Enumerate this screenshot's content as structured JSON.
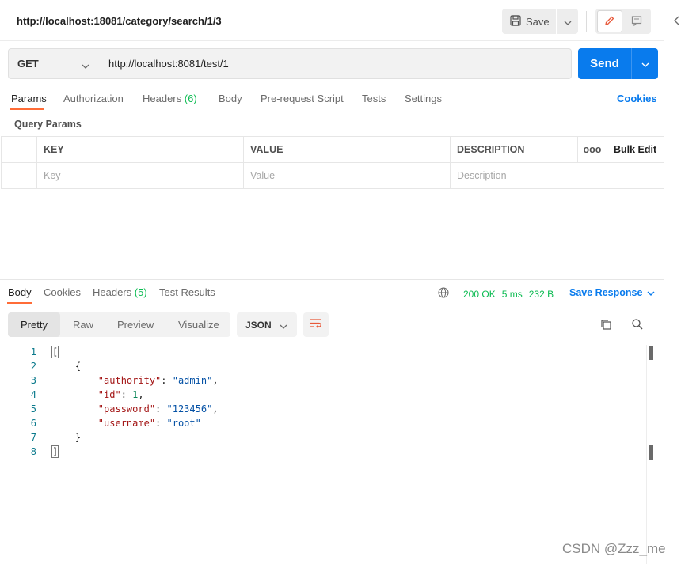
{
  "header": {
    "title": "http://localhost:18081/category/search/1/3",
    "save_label": "Save"
  },
  "request": {
    "method": "GET",
    "url": "http://localhost:8081/test/1",
    "send_label": "Send"
  },
  "request_tabs": {
    "params": "Params",
    "authorization": "Authorization",
    "headers": "Headers",
    "headers_count": "(6)",
    "body": "Body",
    "pre_request": "Pre-request Script",
    "tests": "Tests",
    "settings": "Settings",
    "cookies": "Cookies"
  },
  "query_params": {
    "label": "Query Params",
    "columns": [
      "KEY",
      "VALUE",
      "DESCRIPTION"
    ],
    "more": "ooo",
    "bulk_edit": "Bulk Edit",
    "placeholders": [
      "Key",
      "Value",
      "Description"
    ]
  },
  "response_tabs": {
    "body": "Body",
    "cookies": "Cookies",
    "headers": "Headers",
    "headers_count": "(5)",
    "test_results": "Test Results"
  },
  "response_status": {
    "status": "200 OK",
    "time": "5 ms",
    "size": "232 B",
    "save_response": "Save Response"
  },
  "view_modes": [
    "Pretty",
    "Raw",
    "Preview",
    "Visualize"
  ],
  "format": "JSON",
  "code": {
    "line_numbers": [
      "1",
      "2",
      "3",
      "4",
      "5",
      "6",
      "7",
      "8"
    ],
    "open_bracket": "[",
    "open_brace": "{",
    "authority_key": "\"authority\"",
    "authority_val": "\"admin\"",
    "id_key": "\"id\"",
    "id_val": "1",
    "password_key": "\"password\"",
    "password_val": "\"123456\"",
    "username_key": "\"username\"",
    "username_val": "\"root\"",
    "close_brace": "}",
    "close_bracket": "]"
  },
  "watermark": "CSDN @Zzz_me",
  "colors": {
    "accent": "#ff6c37",
    "primary": "#097bed",
    "success": "#0cbb52"
  }
}
